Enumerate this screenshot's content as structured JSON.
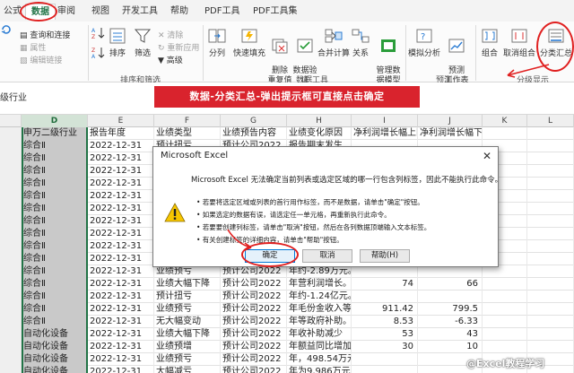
{
  "tabs": [
    {
      "label": "公式"
    },
    {
      "label": "数据"
    },
    {
      "label": "审阅"
    },
    {
      "label": "视图"
    },
    {
      "label": "开发工具"
    },
    {
      "label": "帮助"
    },
    {
      "label": "PDF工具"
    },
    {
      "label": "PDF工具集"
    }
  ],
  "ribbon": {
    "query_items": [
      "查询和连接",
      "属性",
      "编辑链接"
    ],
    "sort_filter": {
      "sort": "排序",
      "filter": "筛选",
      "clear": "清除",
      "reapply": "重新应用",
      "advanced": "高级",
      "group_label": "排序和筛选"
    },
    "data_tools": {
      "split": "分列",
      "flash_fill": "快速填充",
      "remove_dup": "删除\n重复值",
      "validation": "数据验\n证",
      "consolidate": "合并计算",
      "relationships": "关系",
      "model": "管理数\n据模型",
      "group_label": "数据工具"
    },
    "forecast": {
      "whatif": "模拟分析",
      "sheet": "预测\n工作表",
      "group_label": "预测"
    },
    "outline": {
      "group": "组合",
      "ungroup": "取消组合",
      "subtotal": "分类汇总",
      "group_label": "分级显示"
    }
  },
  "formula_bar": {
    "namebox": "级行业",
    "banner": "数据-分类汇总-弹出提示框可直接点击确定"
  },
  "columns": [
    "D",
    "E",
    "F",
    "G",
    "H",
    "I",
    "J",
    "K",
    "L"
  ],
  "grid": {
    "header_row": [
      "申万二级行业",
      "报告年度",
      "业绩类型",
      "业绩预告内容",
      "业绩变化原因",
      "净利润增长幅上限",
      "净利润增长幅下限(%)",
      "",
      ""
    ],
    "rows": [
      [
        "综合Ⅱ",
        "2022-12-31",
        "预计扭亏",
        "预计公司2022",
        "报告期末发生",
        "",
        "",
        "",
        ""
      ],
      [
        "综合Ⅱ",
        "2022-12-31",
        "",
        "",
        "",
        "",
        "",
        "",
        ""
      ],
      [
        "综合Ⅱ",
        "2022-12-31",
        "",
        "",
        "",
        "",
        "",
        "",
        ""
      ],
      [
        "综合Ⅱ",
        "2022-12-31",
        "",
        "",
        "",
        "",
        "",
        "",
        ""
      ],
      [
        "综合Ⅱ",
        "2022-12-31",
        "",
        "",
        "",
        "",
        "",
        "",
        ""
      ],
      [
        "综合Ⅱ",
        "2022-12-31",
        "",
        "",
        "",
        "",
        "",
        "",
        ""
      ],
      [
        "综合Ⅱ",
        "2022-12-31",
        "",
        "",
        "",
        "",
        "",
        "",
        ""
      ],
      [
        "综合Ⅱ",
        "2022-12-31",
        "",
        "",
        "",
        "",
        "",
        "",
        ""
      ],
      [
        "综合Ⅱ",
        "2022-12-31",
        "",
        "",
        "",
        "",
        "",
        "",
        ""
      ],
      [
        "综合Ⅱ",
        "2022-12-31",
        "",
        "",
        "",
        "",
        "",
        "",
        ""
      ],
      [
        "综合Ⅱ",
        "2022-12-31",
        "业绩预亏",
        "预计公司2022",
        "年约-2.89万元。",
        "",
        "",
        "",
        ""
      ],
      [
        "综合Ⅱ",
        "2022-12-31",
        "业绩大幅下降",
        "预计公司2022",
        "年营利润增长。",
        "74",
        "66",
        "",
        ""
      ],
      [
        "综合Ⅱ",
        "2022-12-31",
        "预计扭亏",
        "预计公司2022",
        "年约-1.24亿元。",
        "",
        "",
        "",
        ""
      ],
      [
        "综合Ⅱ",
        "2022-12-31",
        "业绩预亏",
        "预计公司2022",
        "年毛份金收入等。",
        "911.42",
        "799.5",
        "",
        ""
      ],
      [
        "综合Ⅱ",
        "2022-12-31",
        "无大幅变动",
        "预计公司2022",
        "年等政府补助。",
        "8.53",
        "-6.33",
        "",
        ""
      ],
      [
        "自动化设备",
        "2022-12-31",
        "业绩大幅下降",
        "预计公司2022",
        "年收补助减少",
        "53",
        "43",
        "",
        ""
      ],
      [
        "自动化设备",
        "2022-12-31",
        "业绩预增",
        "预计公司2022",
        "年额益同比增加",
        "30",
        "10",
        "",
        ""
      ],
      [
        "自动化设备",
        "2022-12-31",
        "业绩预亏",
        "预计公司2022",
        "年，498.54万元",
        "",
        "",
        "",
        ""
      ],
      [
        "自动化设备",
        "2022-12-31",
        "大幅减亏",
        "预计公司2022",
        "年为9,986万元",
        "",
        "",
        "",
        ""
      ]
    ]
  },
  "dialog": {
    "title": "Microsoft Excel",
    "close": "✕",
    "message": "Microsoft Excel 无法确定当前列表或选定区域的哪一行包含列标签，因此不能执行此命令。",
    "bullets": [
      "• 若要将选定区域或列表的首行用作标签，而不是数据，请单击\"确定\"按钮。",
      "• 如果选定的数据有误，请选定任一单元格，再重新执行此命令。",
      "• 若要要创建列标签，请单击\"取消\"按钮，然后在各列数据顶端输入文本标签。",
      "• 有关创建标签的详细内容，请单击\"帮助\"按钮。"
    ],
    "ok": "确定",
    "cancel": "取消",
    "help": "帮助(H)"
  },
  "watermark": "@Excel教程学习",
  "colors": {
    "accent": "#217346",
    "banner": "#d9232d",
    "annotation": "#e02020"
  }
}
